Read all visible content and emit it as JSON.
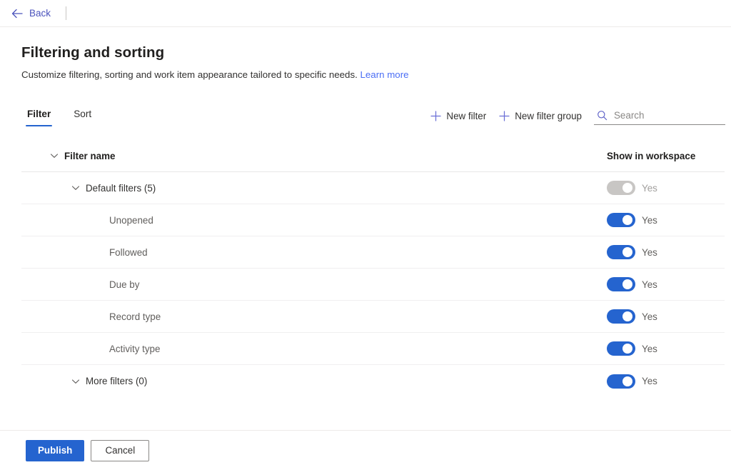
{
  "topbar": {
    "back_label": "Back",
    "back_icon": "arrow-left-icon"
  },
  "header": {
    "title": "Filtering and sorting",
    "description": "Customize filtering, sorting and work item appearance tailored to specific needs.",
    "learn_more_label": "Learn more"
  },
  "tabs": [
    {
      "label": "Filter",
      "active": true
    },
    {
      "label": "Sort",
      "active": false
    }
  ],
  "toolbar": {
    "new_filter_label": "New filter",
    "new_filter_group_label": "New filter group",
    "add_icon": "plus-icon"
  },
  "search": {
    "placeholder": "Search",
    "value": "",
    "icon": "search-icon"
  },
  "table": {
    "columns": {
      "name": "Filter name",
      "show_in_workspace": "Show in workspace"
    },
    "rows": [
      {
        "label": "Default filters (5)",
        "indent": 1,
        "expandable": true,
        "toggle_on": true,
        "toggle_disabled": true,
        "toggle_label": "Yes"
      },
      {
        "label": "Unopened",
        "indent": 2,
        "expandable": false,
        "toggle_on": true,
        "toggle_disabled": false,
        "toggle_label": "Yes"
      },
      {
        "label": "Followed",
        "indent": 2,
        "expandable": false,
        "toggle_on": true,
        "toggle_disabled": false,
        "toggle_label": "Yes"
      },
      {
        "label": "Due by",
        "indent": 2,
        "expandable": false,
        "toggle_on": true,
        "toggle_disabled": false,
        "toggle_label": "Yes"
      },
      {
        "label": "Record type",
        "indent": 2,
        "expandable": false,
        "toggle_on": true,
        "toggle_disabled": false,
        "toggle_label": "Yes"
      },
      {
        "label": "Activity type",
        "indent": 2,
        "expandable": false,
        "toggle_on": true,
        "toggle_disabled": false,
        "toggle_label": "Yes"
      },
      {
        "label": "More filters (0)",
        "indent": 1,
        "expandable": true,
        "toggle_on": true,
        "toggle_disabled": false,
        "toggle_label": "Yes"
      }
    ]
  },
  "footer": {
    "publish_label": "Publish",
    "cancel_label": "Cancel"
  },
  "colors": {
    "accent": "#2564cf",
    "link": "#4b6ef5",
    "back_link": "#4b53bc",
    "toggle_on": "#2564cf",
    "toggle_disabled": "#c8c6c4",
    "divider": "#edebe9"
  }
}
